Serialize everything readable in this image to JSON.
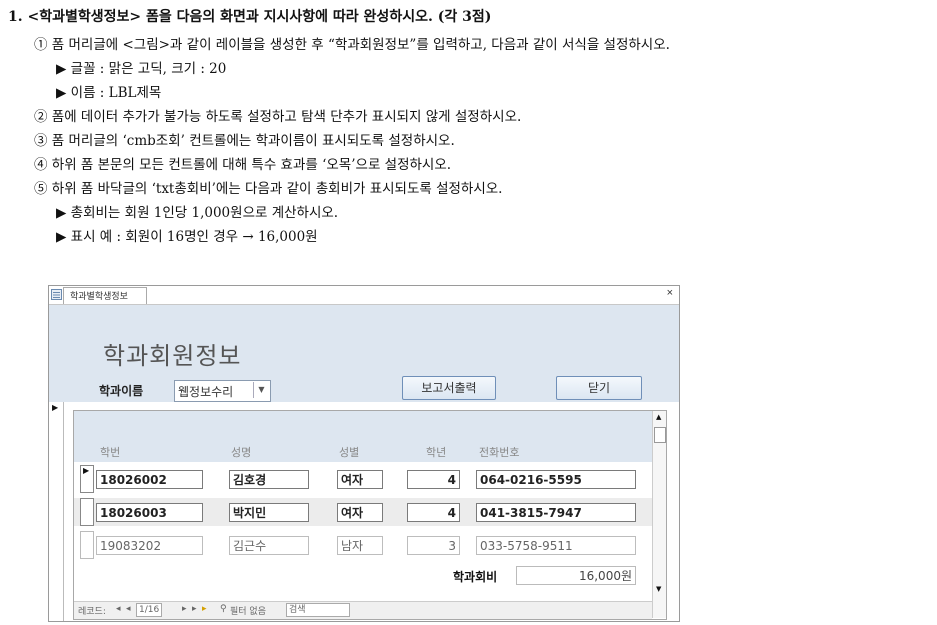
{
  "question": {
    "title": "1. <학과별학생정보> 폼을 다음의 화면과 지시사항에 따라 완성하시오. (각 3점)",
    "lines": [
      "① 폼 머리글에 <그림>과 같이 레이블을 생성한 후 “학과회원정보”를 입력하고, 다음과 같이 서식을 설정하시오.",
      "▶ 글꼴 : 맑은 고딕, 크기 : 20",
      "▶ 이름 : LBL제목",
      "② 폼에 데이터 추가가 불가능 하도록 설정하고 탐색 단추가 표시되지 않게 설정하시오.",
      "③ 폼 머리글의 ‘cmb조회’ 컨트롤에는 학과이름이 표시되도록 설정하시오.",
      "④ 하위 폼 본문의 모든 컨트롤에 대해 특수 효과를 ‘오목’으로 설정하시오.",
      "⑤ 하위 폼 바닥글의 ‘txt총회비’에는 다음과 같이 총회비가 표시되도록 설정하시오.",
      "▶ 총회비는 회원 1인당 1,000원으로 계산하시오.",
      "▶ 표시 예 : 회원이 16명인 경우 → 16,000원"
    ]
  },
  "window": {
    "tab_label": "학과별학생정보",
    "close_glyph": "×",
    "header_title": "학과회원정보",
    "dept_label": "학과이름",
    "dept_value": "웹정보수리",
    "report_button": "보고서출력",
    "close_button": "닫기",
    "record_selector_glyph": "▶"
  },
  "subform": {
    "columns": [
      "학번",
      "성명",
      "성별",
      "학년",
      "전화번호"
    ],
    "rows": [
      {
        "id": "18026002",
        "name": "김호경",
        "gender": "여자",
        "grade": "4",
        "phone": "064-0216-5595"
      },
      {
        "id": "18026003",
        "name": "박지민",
        "gender": "여자",
        "grade": "4",
        "phone": "041-3815-7947"
      },
      {
        "id": "19083202",
        "name": "김근수",
        "gender": "남자",
        "grade": "3",
        "phone": "033-5758-9511"
      }
    ],
    "fee_label": "학과회비",
    "fee_value": "16,000원",
    "nav": {
      "record_label": "레코드:",
      "first": "◂",
      "prev": "◂",
      "position": "1/16",
      "next": "▸",
      "last": "▸",
      "new": "▸",
      "filter": "필터 없음",
      "search": "검색"
    }
  }
}
